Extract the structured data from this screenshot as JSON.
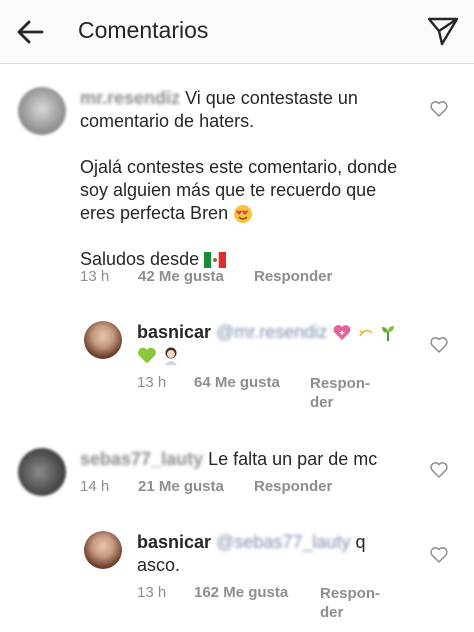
{
  "header": {
    "title": "Comentarios",
    "back_icon": "back-arrow-icon",
    "send_icon": "paper-plane-icon"
  },
  "comments": [
    {
      "username": "mr.resendiz",
      "text_lines": [
        "Vi que contestaste  un",
        "comentario de haters.",
        "",
        "Ojalá contestes este comentario, donde",
        "soy alguien más que te recuerdo que",
        "eres perfecta Bren",
        "",
        "Saludos desde"
      ],
      "time": "13 h",
      "likes": "42 Me gusta",
      "reply_label": "Responder"
    },
    {
      "username": "basnicar",
      "mention": "@mr.resendiz",
      "time": "13 h",
      "likes": "64 Me gusta",
      "reply_label_1": "Respon-",
      "reply_label_2": "der"
    },
    {
      "username": "sebas77_lauty",
      "text": "Le falta un par de mc",
      "time": "14 h",
      "likes": "21 Me gusta",
      "reply_label": "Responder"
    },
    {
      "username": "basnicar",
      "mention": "@sebas77_lauty",
      "text_1": "q",
      "text_2": "asco.",
      "time": "13 h",
      "likes": "162 Me gusta",
      "reply_label_1": "Respon-",
      "reply_label_2": "der"
    }
  ]
}
